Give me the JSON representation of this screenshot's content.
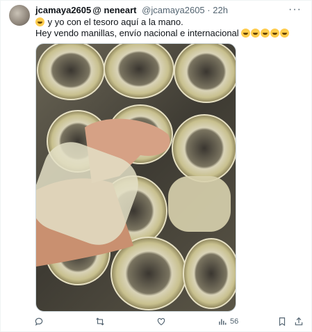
{
  "post": {
    "author_name": "jcamaya2605",
    "reply_to": "@ neneart",
    "handle": "@jcamaya2605",
    "separator": "·",
    "time": "22h",
    "line1": "y yo con el tesoro aquí a la mano.",
    "line2": "Hey vendo manillas, envío nacional e internacional",
    "media_alt": "photo-tape-rolls",
    "views": "56",
    "more_glyph": "···"
  },
  "colors": {
    "muted": "#536471",
    "border": "#cfd9de",
    "emoji": "#ffcc4d"
  },
  "icons": [
    "reply-icon",
    "repost-icon",
    "like-icon",
    "views-icon",
    "bookmark-icon",
    "share-icon"
  ]
}
